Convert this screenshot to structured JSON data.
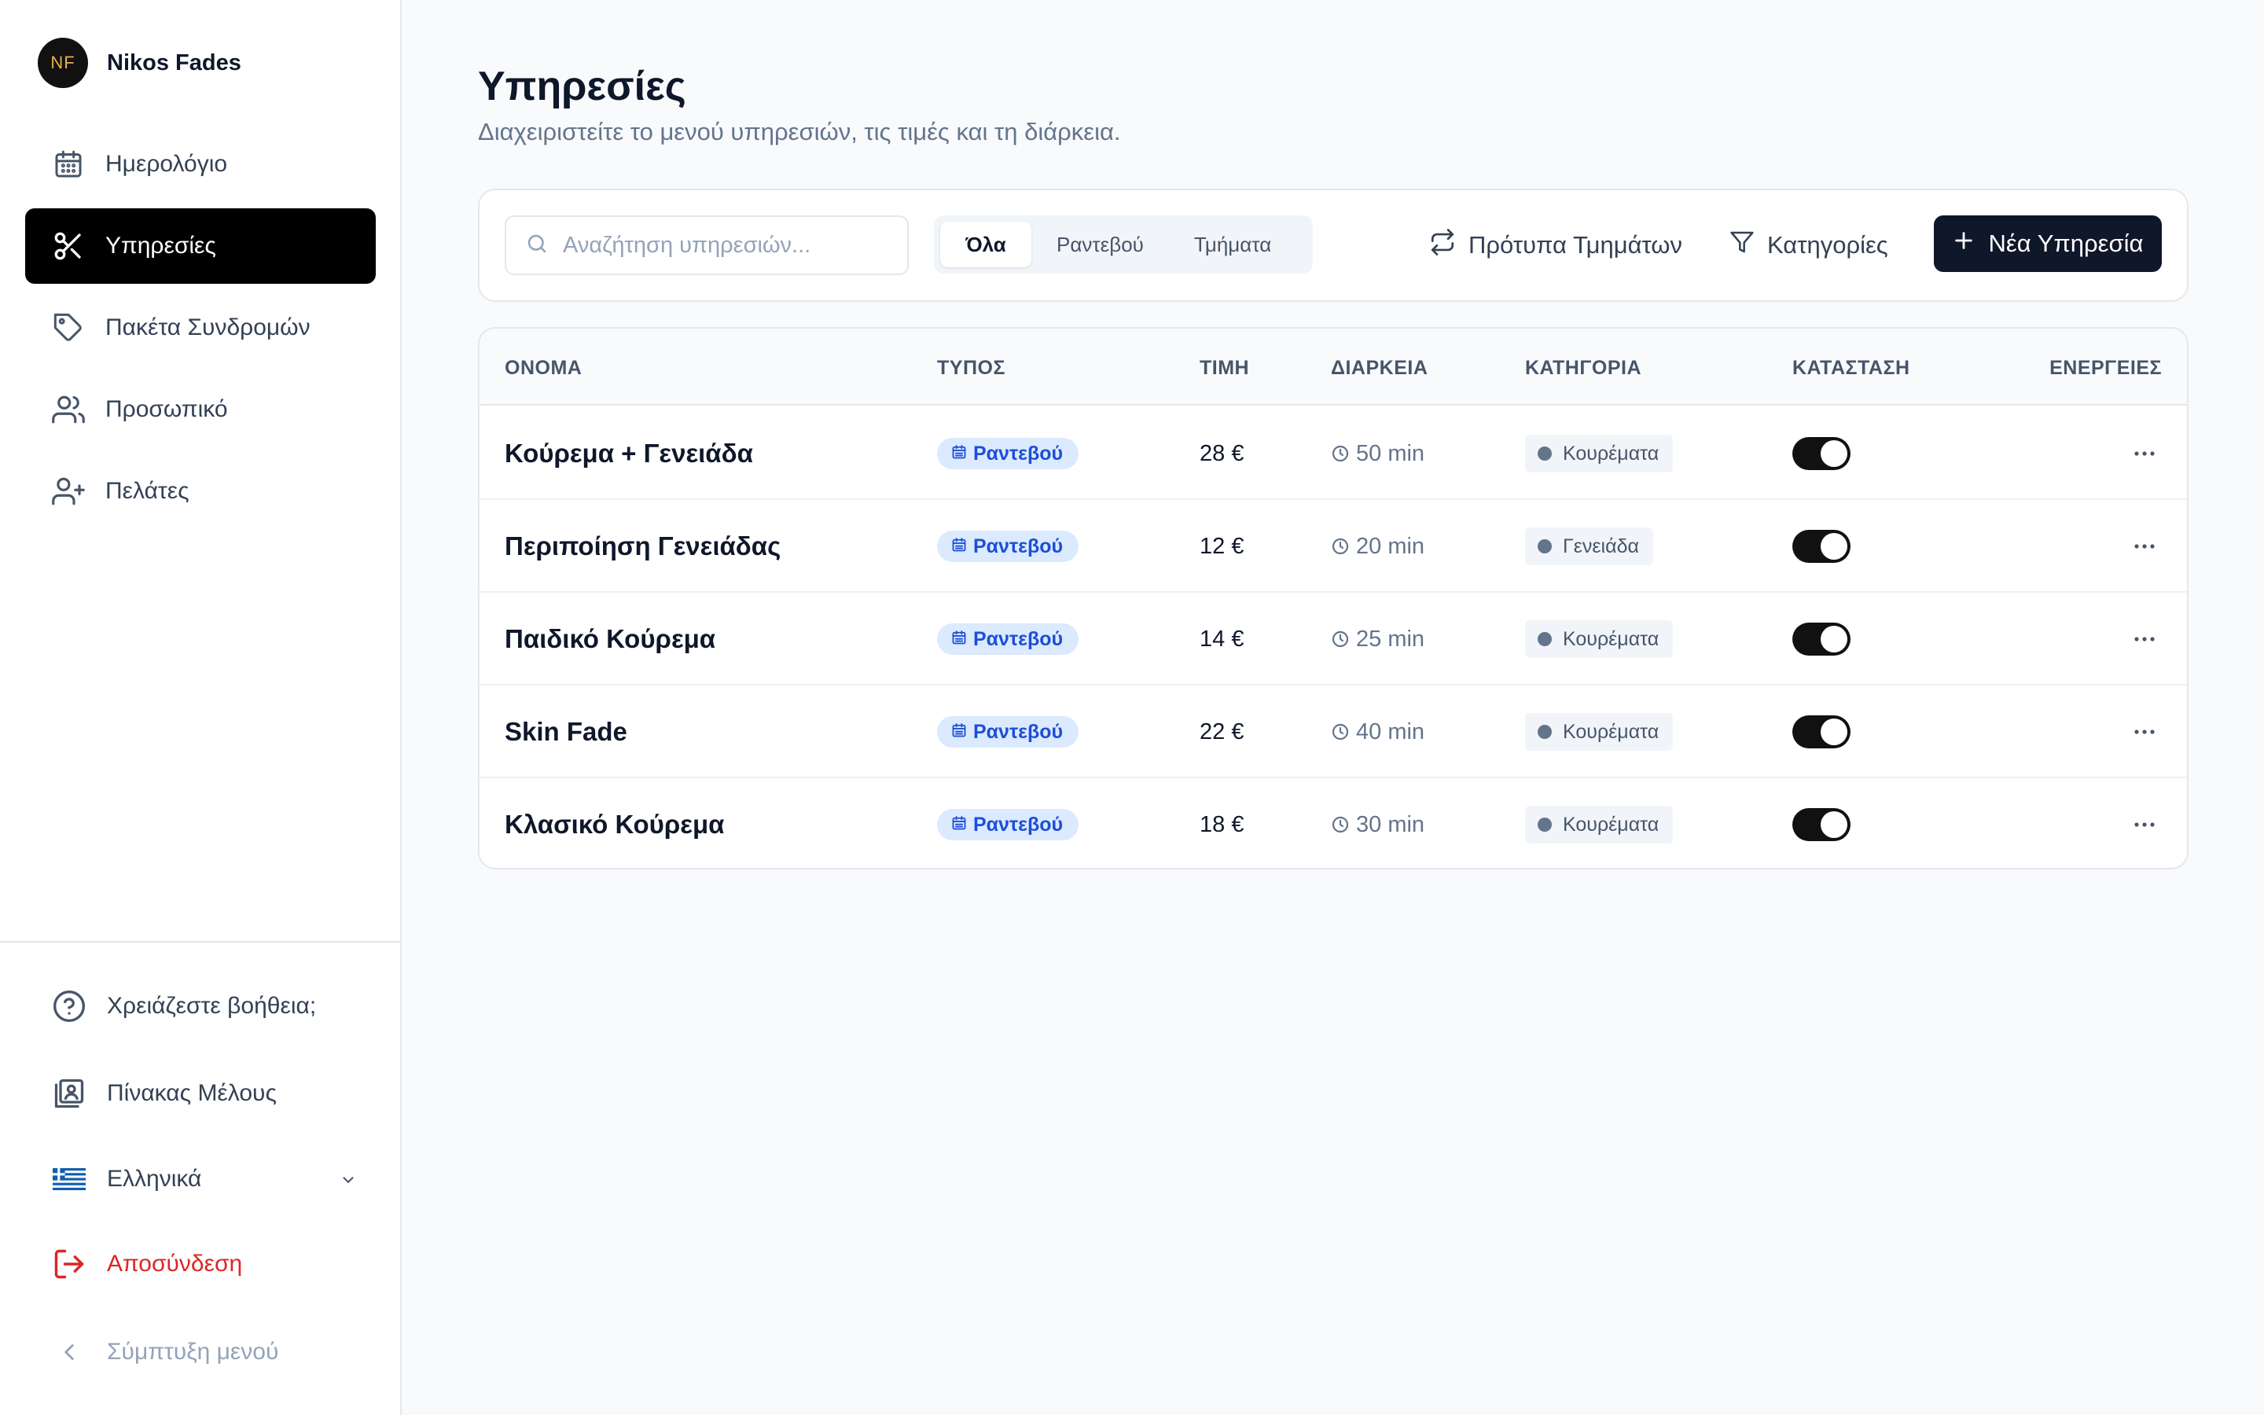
{
  "user": {
    "initials": "NF",
    "name": "Nikos Fades"
  },
  "nav": {
    "items": [
      {
        "label": "Ημερολόγιο",
        "icon": "calendar-icon",
        "active": false
      },
      {
        "label": "Υπηρεσίες",
        "icon": "scissors-icon",
        "active": true
      },
      {
        "label": "Πακέτα Συνδρομών",
        "icon": "tag-icon",
        "active": false
      },
      {
        "label": "Προσωπικό",
        "icon": "users-icon",
        "active": false
      },
      {
        "label": "Πελάτες",
        "icon": "user-plus-icon",
        "active": false
      }
    ]
  },
  "footer": {
    "help": "Χρειάζεστε βοήθεια;",
    "member_board": "Πίνακας Μέλους",
    "language": "Ελληνικά",
    "logout": "Αποσύνδεση",
    "collapse": "Σύμπτυξη μενού"
  },
  "page": {
    "title": "Υπηρεσίες",
    "subtitle": "Διαχειριστείτε το μενού υπηρεσιών, τις τιμές και τη διάρκεια."
  },
  "toolbar": {
    "search_placeholder": "Αναζήτηση υπηρεσιών...",
    "tabs": [
      "Όλα",
      "Ραντεβού",
      "Τμήματα"
    ],
    "active_tab": "Όλα",
    "templates_label": "Πρότυπα Τμημάτων",
    "categories_label": "Κατηγορίες",
    "new_service_label": "Νέα Υπηρεσία"
  },
  "table": {
    "columns": [
      "ΟΝΟΜΑ",
      "ΤΥΠΟΣ",
      "ΤΙΜΗ",
      "ΔΙΑΡΚΕΙΑ",
      "ΚΑΤΗΓΟΡΙΑ",
      "ΚΑΤΑΣΤΑΣΗ",
      "ΕΝΕΡΓΕΙΕΣ"
    ],
    "rows": [
      {
        "name": "Κούρεμα + Γενειάδα",
        "type": "Ραντεβού",
        "price": "28 €",
        "duration": "50 min",
        "category": "Κουρέματα",
        "active": true
      },
      {
        "name": "Περιποίηση Γενειάδας",
        "type": "Ραντεβού",
        "price": "12 €",
        "duration": "20 min",
        "category": "Γενειάδα",
        "active": true
      },
      {
        "name": "Παιδικό Κούρεμα",
        "type": "Ραντεβού",
        "price": "14 €",
        "duration": "25 min",
        "category": "Κουρέματα",
        "active": true
      },
      {
        "name": "Skin Fade",
        "type": "Ραντεβού",
        "price": "22 €",
        "duration": "40 min",
        "category": "Κουρέματα",
        "active": true
      },
      {
        "name": "Κλασικό Κούρεμα",
        "type": "Ραντεβού",
        "price": "18 €",
        "duration": "30 min",
        "category": "Κουρέματα",
        "active": true
      }
    ]
  },
  "colors": {
    "primary": "#0f172a",
    "active_nav": "#000000",
    "badge_bg": "#dbeafe",
    "badge_text": "#1d4ed8",
    "logout": "#dc2626"
  }
}
